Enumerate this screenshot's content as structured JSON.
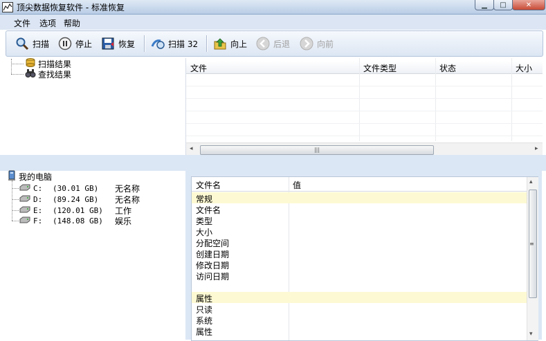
{
  "window": {
    "title": "顶尖数据恢复软件 - 标准恢复",
    "icon": "chart-line-icon"
  },
  "menu": {
    "items": [
      "文件",
      "选项",
      "帮助"
    ]
  },
  "toolbar": {
    "scan": "扫描",
    "stop": "停止",
    "restore": "恢复",
    "scan32": "扫描 32",
    "up": "向上",
    "back": "后退",
    "forward": "向前"
  },
  "left_tree": {
    "scan_results": "扫描结果",
    "find_results": "查找结果"
  },
  "file_table": {
    "columns": [
      "文件",
      "文件类型",
      "状态",
      "大小"
    ],
    "rows": []
  },
  "computer": {
    "label": "我的电脑",
    "drives": [
      {
        "letter": "C:",
        "size": "(30.01 GB)",
        "name": "无名称"
      },
      {
        "letter": "D:",
        "size": "(89.24 GB)",
        "name": "无名称"
      },
      {
        "letter": "E:",
        "size": "(120.01 GB)",
        "name": "工作"
      },
      {
        "letter": "F:",
        "size": "(148.08 GB)",
        "name": "娱乐"
      }
    ]
  },
  "properties": {
    "columns": [
      "文件名",
      "值"
    ],
    "rows": [
      {
        "label": "常规",
        "group": true
      },
      {
        "label": "文件名",
        "group": false
      },
      {
        "label": "类型",
        "group": false
      },
      {
        "label": "大小",
        "group": false
      },
      {
        "label": "分配空间",
        "group": false
      },
      {
        "label": "创建日期",
        "group": false
      },
      {
        "label": "修改日期",
        "group": false
      },
      {
        "label": "访问日期",
        "group": false
      },
      {
        "label": "",
        "group": false
      },
      {
        "label": "属性",
        "group": true
      },
      {
        "label": "只读",
        "group": false
      },
      {
        "label": "系统",
        "group": false
      },
      {
        "label": "属性",
        "group": false
      }
    ]
  },
  "colors": {
    "panel_background": "#dce7f5",
    "group_row": "#fdf9d2"
  }
}
